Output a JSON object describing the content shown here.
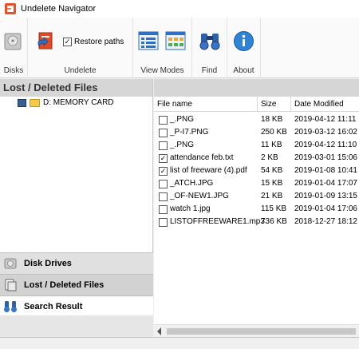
{
  "window": {
    "title": "Undelete Navigator",
    "app_icon": "undelete-navigator-app-icon"
  },
  "ribbon": {
    "disks_label": "Disks",
    "undelete_label": "Undelete",
    "restore_paths_label": "Restore paths",
    "restore_paths_checked": true,
    "view_modes_label": "View Modes",
    "find_label": "Find",
    "about_label": "About"
  },
  "left_panel": {
    "header": "Lost / Deleted Files",
    "tree": [
      {
        "label": "D: MEMORY CARD"
      }
    ],
    "nav": [
      {
        "label": "Disk Drives",
        "icon": "disk-drive-icon"
      },
      {
        "label": "Lost / Deleted Files",
        "icon": "deleted-files-icon",
        "active": true
      },
      {
        "label": "Search Result",
        "icon": "binoculars-icon"
      }
    ]
  },
  "file_list": {
    "columns": [
      "File name",
      "Size",
      "Date Modified"
    ],
    "rows": [
      {
        "name": "_.PNG",
        "size": "18 KB",
        "date": "2019-04-12 11:11",
        "checked": false
      },
      {
        "name": "_P-I7.PNG",
        "size": "250 KB",
        "date": "2019-03-12 16:02",
        "checked": false
      },
      {
        "name": "_.PNG",
        "size": "11 KB",
        "date": "2019-04-12 11:10",
        "checked": false
      },
      {
        "name": "attendance feb.txt",
        "size": "2 KB",
        "date": "2019-03-01 15:06",
        "checked": true
      },
      {
        "name": "list of freeware (4).pdf",
        "size": "54 KB",
        "date": "2019-01-08 10:41",
        "checked": true
      },
      {
        "name": "_ATCH.JPG",
        "size": "15 KB",
        "date": "2019-01-04 17:07",
        "checked": false
      },
      {
        "name": "_OF-NEW1.JPG",
        "size": "21 KB",
        "date": "2019-01-09 13:15",
        "checked": false
      },
      {
        "name": "watch 1.jpg",
        "size": "115 KB",
        "date": "2019-01-04 17:06",
        "checked": false
      },
      {
        "name": "LISTOFFREEWARE1.mp3",
        "size": "736 KB",
        "date": "2018-12-27 18:12",
        "checked": false
      }
    ]
  },
  "colors": {
    "accent": "#1f6fc5",
    "header_gray": "#d6d6d6"
  }
}
